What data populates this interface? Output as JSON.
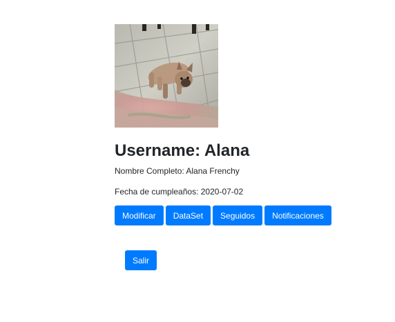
{
  "profile": {
    "photo_alt": "French bulldog on tiled floor",
    "username_prefix": "Username: ",
    "username": "Alana",
    "fullname_label": "Nombre Completo: ",
    "fullname": "Alana Frenchy",
    "birthday_label": "Fecha de cumpleaños: ",
    "birthday": "2020-07-02"
  },
  "actions": {
    "modify_label": "Modificar",
    "dataset_label": "DataSet",
    "following_label": "Seguidos",
    "notifications_label": "Notificaciones",
    "logout_label": "Salir"
  },
  "colors": {
    "primary": "#007bff",
    "text": "#212529",
    "background": "#ffffff"
  }
}
